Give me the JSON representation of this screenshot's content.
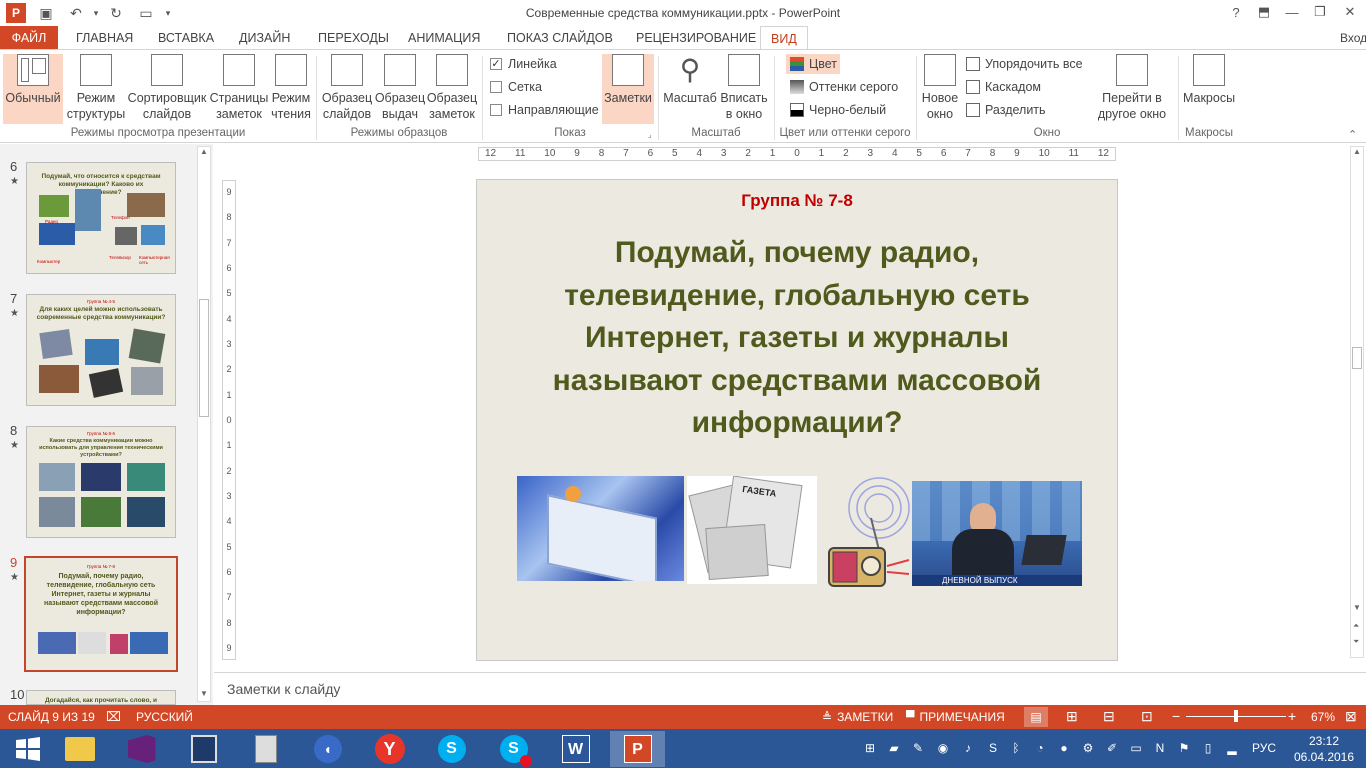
{
  "window": {
    "title": "Современные средства коммуникации.pptx - PowerPoint",
    "help": "?",
    "signin": "Вход"
  },
  "tabs": [
    {
      "label": "ФАЙЛ"
    },
    {
      "label": "ГЛАВНАЯ"
    },
    {
      "label": "ВСТАВКА"
    },
    {
      "label": "ДИЗАЙН"
    },
    {
      "label": "ПЕРЕХОДЫ"
    },
    {
      "label": "АНИМАЦИЯ"
    },
    {
      "label": "ПОКАЗ СЛАЙДОВ"
    },
    {
      "label": "РЕЦЕНЗИРОВАНИЕ"
    },
    {
      "label": "ВИД"
    }
  ],
  "ribbon": {
    "views": {
      "b1": [
        "Обычный",
        ""
      ],
      "b2": [
        "Режим",
        "структуры"
      ],
      "b3": [
        "Сортировщик",
        "слайдов"
      ],
      "b4": [
        "Страницы",
        "заметок"
      ],
      "b5": [
        "Режим",
        "чтения"
      ],
      "label": "Режимы просмотра презентации"
    },
    "masters": {
      "b1": [
        "Образец",
        "слайдов"
      ],
      "b2": [
        "Образец",
        "выдач"
      ],
      "b3": [
        "Образец",
        "заметок"
      ],
      "label": "Режимы образцов"
    },
    "show": {
      "ruler": "Линейка",
      "grid": "Сетка",
      "guides": "Направляющие",
      "notes": "Заметки",
      "label": "Показ"
    },
    "zoom": {
      "zoom": "Масштаб",
      "fit": [
        "Вписать",
        "в окно"
      ],
      "label": "Масштаб"
    },
    "color": {
      "color": "Цвет",
      "gray": "Оттенки серого",
      "bw": "Черно-белый",
      "label": "Цвет или оттенки серого"
    },
    "window": {
      "new": [
        "Новое",
        "окно"
      ],
      "arrange": "Упорядочить все",
      "cascade": "Каскадом",
      "split": "Разделить",
      "switch": [
        "Перейти в",
        "другое окно"
      ],
      "label": "Окно"
    },
    "macros": {
      "macros": "Макросы",
      "label": "Макросы"
    }
  },
  "thumbnails": [
    {
      "num": "6",
      "title": "Подумай, что относится к средствам коммуникации? Каково их назначение?",
      "group": "",
      "labels": [
        "Радио",
        "Телефон",
        "Компьютер",
        "Телевизор",
        "Компьютерная сеть"
      ]
    },
    {
      "num": "7",
      "title": "Для каких целей можно использовать современные средства коммуникации?",
      "group": "Группа № 4-5",
      "labels": []
    },
    {
      "num": "8",
      "title": "Какие средства коммуникации можно использовать для управления техническими устройствами?",
      "group": "Группа № 8-6",
      "labels": []
    },
    {
      "num": "9",
      "title": "Подумай, почему радио, телевидение, глобальную сеть Интернет, газеты и журналы называют средствами массовой информации?",
      "group": "Группа № 7-8",
      "labels": []
    },
    {
      "num": "10",
      "title": "Догадайся, как прочитать слово, и",
      "group": "",
      "labels": []
    }
  ],
  "slide": {
    "group": "Группа № 7-8",
    "title": "Подумай, почему радио, телевидение, глобальную сеть Интернет, газеты и журналы называют средствами массовой информации?",
    "img_newspaper": "ГАЗЕТА",
    "img_tv": "ДНЕВНОЙ ВЫПУСК"
  },
  "ruler_ticks": [
    "12",
    "11",
    "10",
    "9",
    "8",
    "7",
    "6",
    "5",
    "4",
    "3",
    "2",
    "1",
    "0",
    "1",
    "2",
    "3",
    "4",
    "5",
    "6",
    "7",
    "8",
    "9",
    "10",
    "11",
    "12"
  ],
  "vruler_ticks": [
    "9",
    "8",
    "7",
    "6",
    "5",
    "4",
    "3",
    "2",
    "1",
    "0",
    "1",
    "2",
    "3",
    "4",
    "5",
    "6",
    "7",
    "8",
    "9"
  ],
  "notes": {
    "placeholder": "Заметки к слайду"
  },
  "status": {
    "slide": "СЛАЙД 9 ИЗ 19",
    "lang": "РУССКИЙ",
    "notes": "ЗАМЕТКИ",
    "comments": "ПРИМЕЧАНИЯ",
    "zoom": "67%",
    "zoom_level": 0.5
  },
  "taskbar": {
    "lang": "РУС",
    "time": "23:12",
    "date": "06.04.2016"
  },
  "colors": {
    "accent": "#d24726",
    "title_green": "#4f5a1c",
    "group_red": "#c00000",
    "taskbar": "#2b5797"
  }
}
